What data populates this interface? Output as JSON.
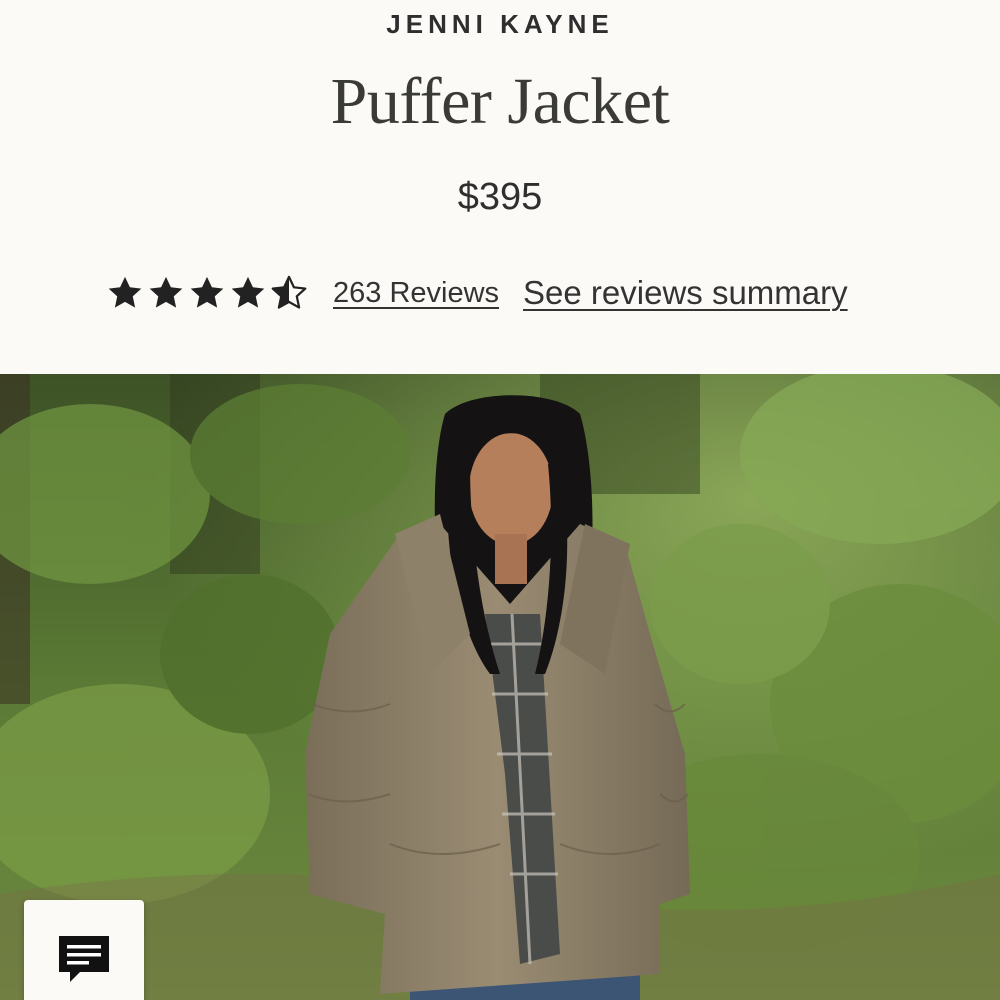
{
  "brand": "JENNI KAYNE",
  "product": {
    "title": "Puffer Jacket",
    "price": "$395"
  },
  "rating": {
    "value": 4.5,
    "max": 5,
    "reviews_label": "263 Reviews",
    "summary_label": "See reviews summary"
  },
  "hero_image": {
    "description_icon": "product-photo",
    "colors": {
      "foliage": "#5f7d3c",
      "jacket": "#8a7d67",
      "hair": "#141212"
    }
  },
  "chat": {
    "icon": "chat-bubble-icon"
  }
}
